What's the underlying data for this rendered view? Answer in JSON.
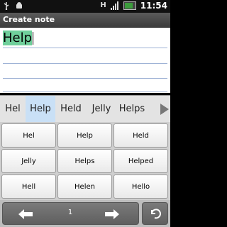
{
  "status_bar": {
    "time": "11:54",
    "icons": [
      "usb-icon",
      "android-icon",
      "h-network-icon",
      "signal-icon",
      "battery-icon"
    ],
    "network_type": "H"
  },
  "title_bar": {
    "title": "Create note"
  },
  "note": {
    "selected_text": "Help"
  },
  "suggestions": [
    {
      "label": "Hel",
      "active": false
    },
    {
      "label": "Help",
      "active": true
    },
    {
      "label": "Held",
      "active": false
    },
    {
      "label": "Jelly",
      "active": false
    },
    {
      "label": "Helps",
      "active": false
    }
  ],
  "keys": [
    [
      "Hel",
      "Help",
      "Held"
    ],
    [
      "Jelly",
      "Helps",
      "Helped"
    ],
    [
      "Hell",
      "Helen",
      "Hello"
    ]
  ],
  "nav": {
    "page": "1",
    "prev_icon": "left-arrow-icon",
    "next_icon": "right-arrow-icon",
    "undo_icon": "undo-icon"
  },
  "colors": {
    "selection": "#6fcf9b",
    "active_suggestion": "#c9e0f6",
    "lines": "#9fb3d6"
  }
}
